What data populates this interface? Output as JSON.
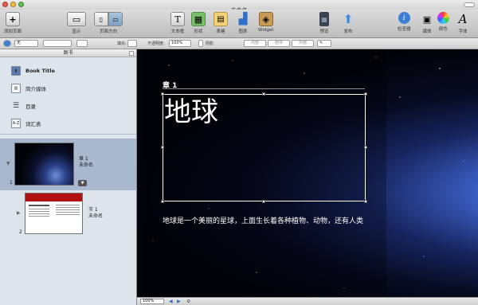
{
  "window": {
    "title": "未命名"
  },
  "toolbar": {
    "add_page": "添加页面",
    "view": "显示",
    "orientation": "页面方向",
    "textbox": "文本框",
    "shapes": "形状",
    "table": "表格",
    "chart": "图表",
    "widget": "Widget",
    "preview": "预览",
    "publish": "发布",
    "inspector": "检查器",
    "media": "媒体",
    "colors": "颜色",
    "fonts": "字体"
  },
  "formatbar": {
    "fill_label": "填充:",
    "opacity_label": "不透明度:",
    "opacity_value": "100%",
    "shadow_label": "阴影",
    "style_none": "无",
    "wrap_1": "内部",
    "wrap_2": "居中",
    "wrap_3": "外部"
  },
  "sidebar": {
    "header": "图书",
    "items": [
      {
        "label": "Book Title",
        "icon": "book-icon"
      },
      {
        "label": "简介媒体",
        "icon": "film-icon"
      },
      {
        "label": "目录",
        "icon": "list-icon"
      },
      {
        "label": "词汇表",
        "icon": "az-icon"
      }
    ],
    "az_glyph": "A-Z",
    "chapter": {
      "number": "1",
      "label_line1": "章 1",
      "label_line2": "未命名"
    },
    "section": {
      "number": "2",
      "label_line1": "节 1",
      "label_line2": "未命名"
    }
  },
  "canvas": {
    "chapter_label": "章 1",
    "title": "地球",
    "body": "地球是一个美丽的星球，上面生长着各种植物、动物，还有人类"
  },
  "statusbar": {
    "zoom": "100%"
  },
  "colors": {
    "selection_row": "#a7b8cf",
    "sidebar_bg": "#dde4ec"
  }
}
